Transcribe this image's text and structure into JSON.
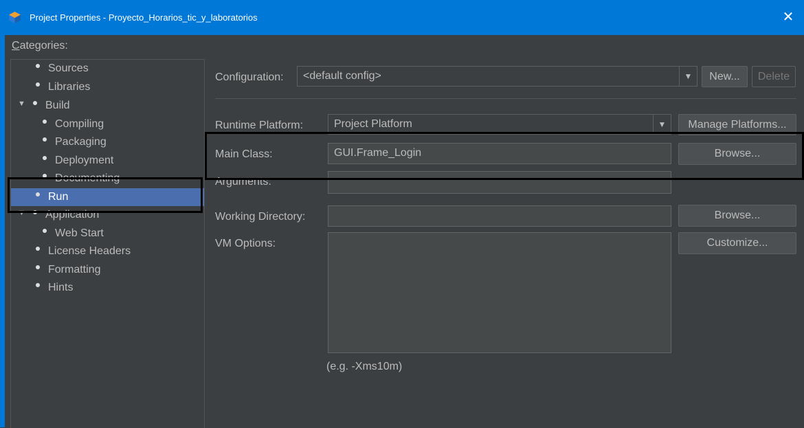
{
  "window": {
    "title": "Project Properties - Proyecto_Horarios_tic_y_laboratorios",
    "close_glyph": "✕",
    "title_icon": "netbeans-icon"
  },
  "categories": {
    "label": "Categories:",
    "items": [
      {
        "label": "Sources"
      },
      {
        "label": "Libraries"
      },
      {
        "label": "Build",
        "expanded": true
      },
      {
        "label": "Compiling"
      },
      {
        "label": "Packaging"
      },
      {
        "label": "Deployment"
      },
      {
        "label": "Documenting"
      },
      {
        "label": "Run",
        "selected": true
      },
      {
        "label": "Application",
        "expanded": true
      },
      {
        "label": "Web Start"
      },
      {
        "label": "License Headers"
      },
      {
        "label": "Formatting"
      },
      {
        "label": "Hints"
      }
    ]
  },
  "configuration": {
    "label": "Configuration:",
    "value": "<default config>",
    "new_label": "New...",
    "delete_label": "Delete"
  },
  "runtime_platform": {
    "label": "Runtime Platform:",
    "value": "Project Platform",
    "manage_label": "Manage Platforms..."
  },
  "main_class": {
    "label": "Main Class:",
    "value": "GUI.Frame_Login",
    "browse_label": "Browse..."
  },
  "arguments": {
    "label": "Arguments:",
    "value": ""
  },
  "working_directory": {
    "label": "Working Directory:",
    "value": "",
    "browse_label": "Browse..."
  },
  "vm_options": {
    "label": "VM Options:",
    "value": "",
    "customize_label": "Customize...",
    "hint": "(e.g. -Xms10m)"
  },
  "colors": {
    "titlebar": "#0078d7",
    "background": "#3c3f41",
    "selection": "#4b6eaf"
  }
}
